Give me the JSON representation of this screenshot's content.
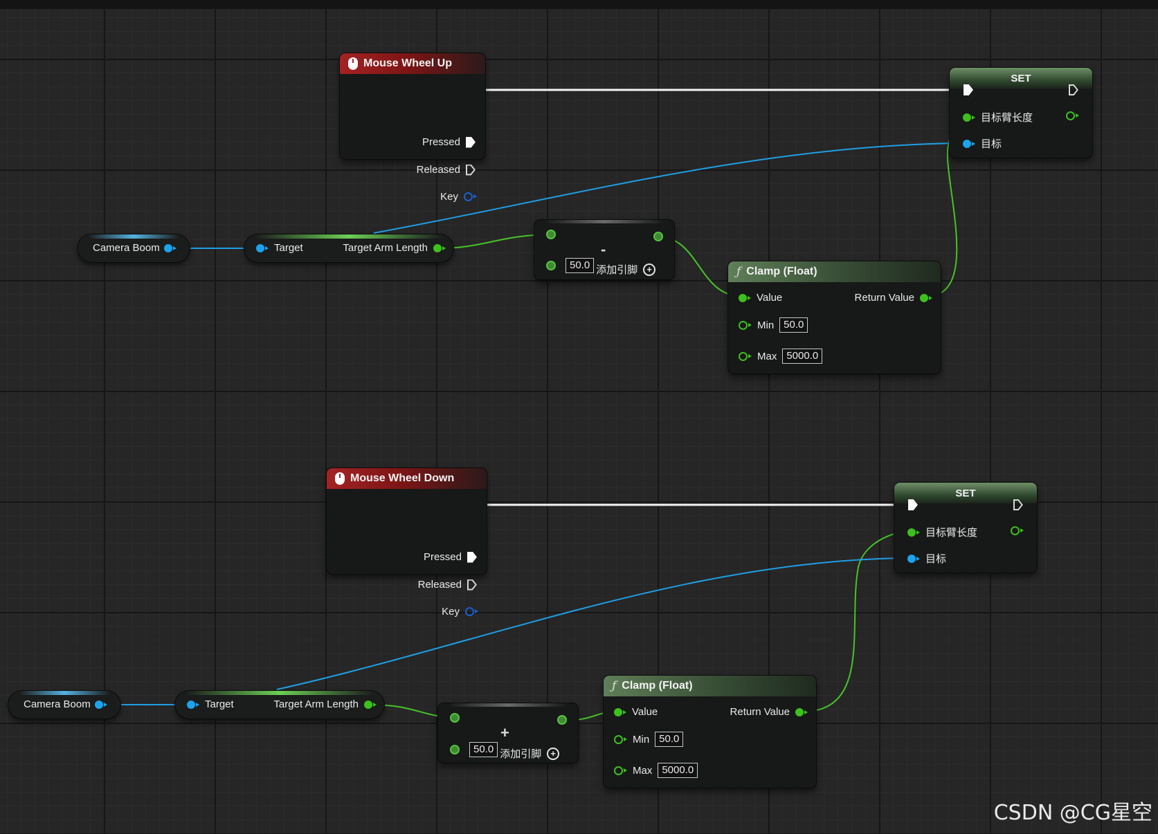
{
  "colors": {
    "exec": "#fafafa",
    "float_pin": "#3cc11c",
    "object_pin": "#1aa3ee",
    "event_header": "#a42323",
    "function_header": "#5f7f58",
    "grid_background": "#262626"
  },
  "graph": {
    "upper": {
      "event": {
        "title": "Mouse Wheel Up",
        "icon": "mouse-icon",
        "pins": {
          "pressed": "Pressed",
          "released": "Released",
          "key": "Key"
        }
      },
      "camera_boom": {
        "label": "Camera Boom"
      },
      "getter": {
        "target": "Target",
        "output": "Target Arm Length"
      },
      "math": {
        "operator": "-",
        "input_value": "50.0",
        "add_pin_label": "添加引脚"
      },
      "clamp": {
        "title": "Clamp (Float)",
        "icon": "function-icon",
        "value": "Value",
        "return_value": "Return Value",
        "min_label": "Min",
        "min_value": "50.0",
        "max_label": "Max",
        "max_value": "5000.0"
      },
      "set": {
        "title": "SET",
        "arm_length": "目标臂长度",
        "target": "目标"
      }
    },
    "lower": {
      "event": {
        "title": "Mouse Wheel Down",
        "icon": "mouse-icon",
        "pins": {
          "pressed": "Pressed",
          "released": "Released",
          "key": "Key"
        }
      },
      "camera_boom": {
        "label": "Camera Boom"
      },
      "getter": {
        "target": "Target",
        "output": "Target Arm Length"
      },
      "math": {
        "operator": "+",
        "input_value": "50.0",
        "add_pin_label": "添加引脚"
      },
      "clamp": {
        "title": "Clamp (Float)",
        "icon": "function-icon",
        "value": "Value",
        "return_value": "Return Value",
        "min_label": "Min",
        "min_value": "50.0",
        "max_label": "Max",
        "max_value": "5000.0"
      },
      "set": {
        "title": "SET",
        "arm_length": "目标臂长度",
        "target": "目标"
      }
    }
  },
  "watermark": "CSDN @CG星空"
}
